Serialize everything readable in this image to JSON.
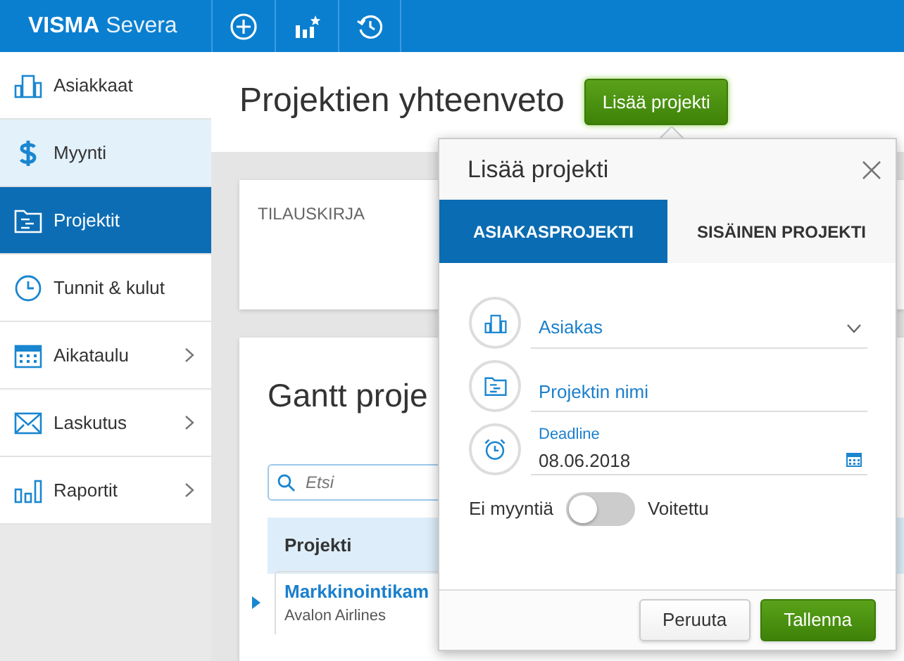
{
  "topbar": {
    "brand_bold": "VISMA",
    "brand_light": "Severa"
  },
  "sidebar": {
    "items": [
      {
        "label": "Asiakkaat",
        "selected": false,
        "hovered": false,
        "has_submenu": false
      },
      {
        "label": "Myynti",
        "selected": false,
        "hovered": true,
        "has_submenu": false
      },
      {
        "label": "Projektit",
        "selected": true,
        "hovered": false,
        "has_submenu": false
      },
      {
        "label": "Tunnit & kulut",
        "selected": false,
        "hovered": false,
        "has_submenu": false
      },
      {
        "label": "Aikataulu",
        "selected": false,
        "hovered": false,
        "has_submenu": true
      },
      {
        "label": "Laskutus",
        "selected": false,
        "hovered": false,
        "has_submenu": true
      },
      {
        "label": "Raportit",
        "selected": false,
        "hovered": false,
        "has_submenu": true
      }
    ]
  },
  "page": {
    "title": "Projektien yhteenveto",
    "add_button": "Lisää projekti"
  },
  "order_card": {
    "title": "TILAUSKIRJA"
  },
  "gantt_card": {
    "title": "Gantt proje",
    "search": {
      "placeholder": "Etsi"
    },
    "table": {
      "columns": [
        "Projekti"
      ],
      "rows": [
        {
          "name": "Markkinointikam",
          "customer": "Avalon Airlines",
          "expanded": false
        }
      ]
    }
  },
  "dialog": {
    "title": "Lisää projekti",
    "tabs": [
      {
        "label": "ASIAKASPROJEKTI",
        "selected": true
      },
      {
        "label": "SISÄINEN PROJEKTI",
        "selected": false
      }
    ],
    "fields": [
      {
        "kind": "select",
        "placeholder": "Asiakas"
      },
      {
        "kind": "text",
        "placeholder": "Projektin nimi"
      },
      {
        "kind": "date",
        "label": "Deadline",
        "value": "08.06.2018"
      }
    ],
    "toggle": {
      "off_label": "Ei myyntiä",
      "on_label": "Voitettu",
      "on": false
    },
    "buttons": [
      {
        "label": "Peruuta",
        "kind": "secondary"
      },
      {
        "label": "Tallenna",
        "kind": "primary"
      }
    ]
  }
}
